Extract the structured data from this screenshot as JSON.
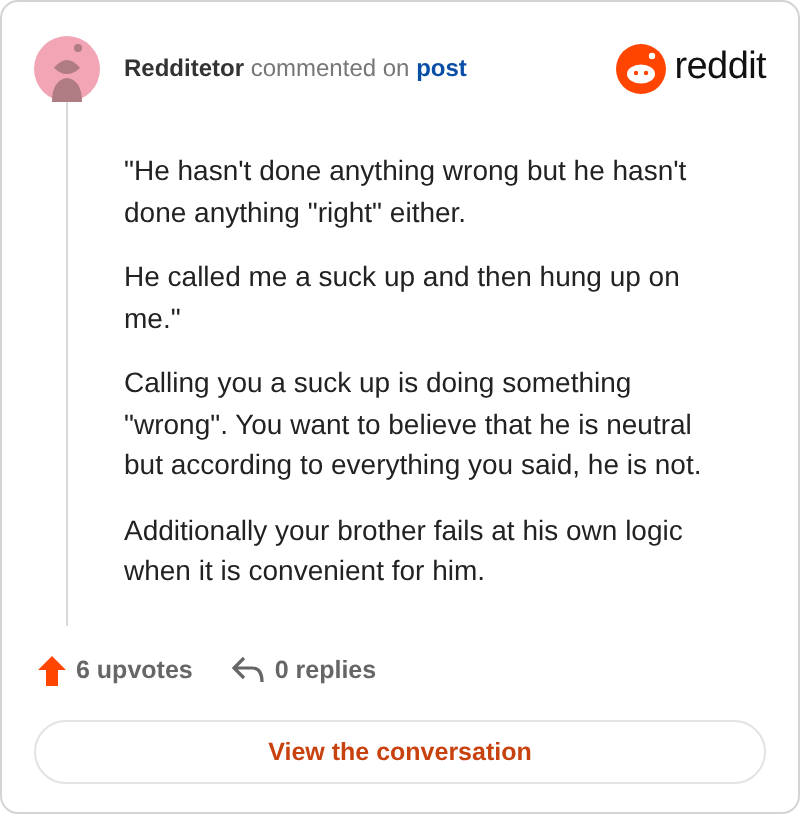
{
  "comment": {
    "author": "Redditetor",
    "action": "commented on",
    "link": "post"
  },
  "brand": "reddit",
  "paragraphs": [
    "\"He hasn't done anything wrong but he hasn't done anything \"right\" either.",
    "He called me a suck up and then hung up on me.\"",
    "Calling you a suck up is doing something \"wrong\". You want to believe that he is neutral but according to everything you said, he is not.",
    "Additionally your brother fails at his own logic when it is convenient for him."
  ],
  "upvotes": "6 upvotes",
  "replies": "0 replies",
  "button": "View the conversation"
}
